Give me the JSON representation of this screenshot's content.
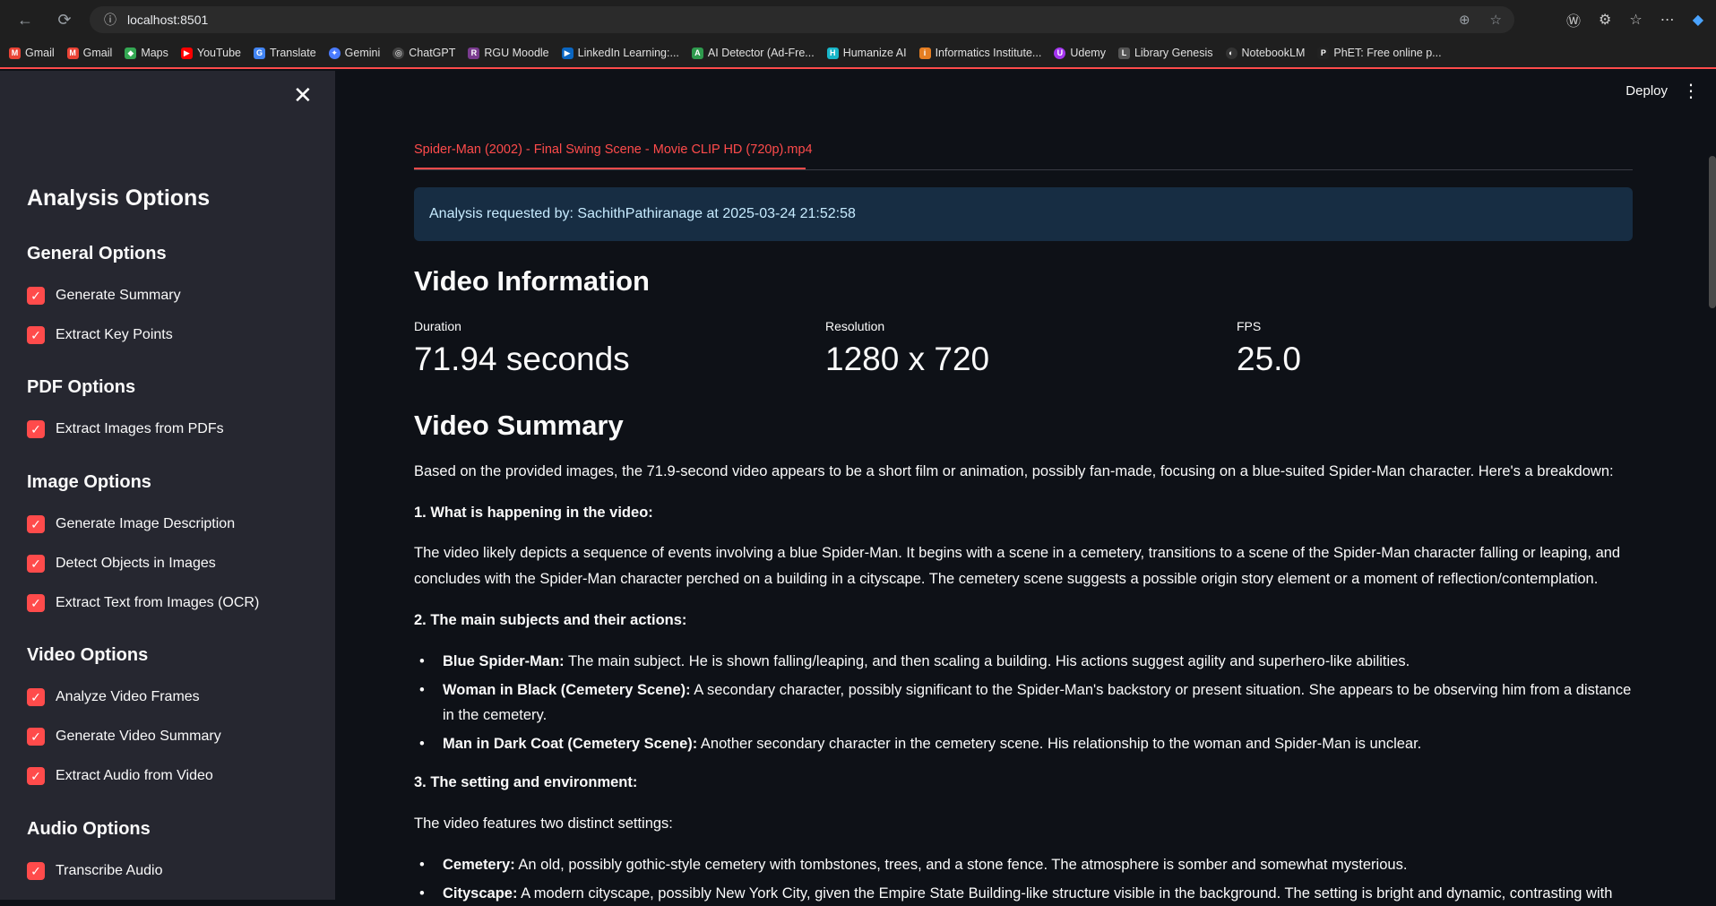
{
  "browser": {
    "url": "localhost:8501",
    "bookmarks": [
      "Gmail",
      "Gmail",
      "Maps",
      "YouTube",
      "Translate",
      "Gemini",
      "ChatGPT",
      "RGU Moodle",
      "LinkedIn Learning:...",
      "AI Detector (Ad-Fre...",
      "Humanize AI",
      "Informatics Institute...",
      "Udemy",
      "Library Genesis",
      "NotebookLM",
      "PhET: Free online p..."
    ]
  },
  "sidebar": {
    "title": "Analysis Options",
    "sections": [
      {
        "title": "General Options",
        "items": [
          "Generate Summary",
          "Extract Key Points"
        ]
      },
      {
        "title": "PDF Options",
        "items": [
          "Extract Images from PDFs"
        ]
      },
      {
        "title": "Image Options",
        "items": [
          "Generate Image Description",
          "Detect Objects in Images",
          "Extract Text from Images (OCR)"
        ]
      },
      {
        "title": "Video Options",
        "items": [
          "Analyze Video Frames",
          "Generate Video Summary",
          "Extract Audio from Video"
        ]
      },
      {
        "title": "Audio Options",
        "items": [
          "Transcribe Audio"
        ]
      }
    ]
  },
  "header": {
    "deploy": "Deploy"
  },
  "main": {
    "tab": "Spider-Man (2002) - Final Swing Scene - Movie CLIP HD (720p).mp4",
    "info": "Analysis requested by: SachithPathiranage at 2025-03-24 21:52:58",
    "video_info_title": "Video Information",
    "metrics": [
      {
        "label": "Duration",
        "value": "71.94 seconds"
      },
      {
        "label": "Resolution",
        "value": "1280 x 720"
      },
      {
        "label": "FPS",
        "value": "25.0"
      }
    ],
    "summary_title": "Video Summary",
    "intro": "Based on the provided images, the 71.9-second video appears to be a short film or animation, possibly fan-made, focusing on a blue-suited Spider-Man character. Here's a breakdown:",
    "h1": "1. What is happening in the video:",
    "p1": "The video likely depicts a sequence of events involving a blue Spider-Man. It begins with a scene in a cemetery, transitions to a scene of the Spider-Man character falling or leaping, and concludes with the Spider-Man character perched on a building in a cityscape. The cemetery scene suggests a possible origin story element or a moment of reflection/contemplation.",
    "h2": "2. The main subjects and their actions:",
    "b1_bold": "Blue Spider-Man:",
    "b1": " The main subject. He is shown falling/leaping, and then scaling a building. His actions suggest agility and superhero-like abilities.",
    "b2_bold": "Woman in Black (Cemetery Scene):",
    "b2": " A secondary character, possibly significant to the Spider-Man's backstory or present situation. She appears to be observing him from a distance in the cemetery.",
    "b3_bold": "Man in Dark Coat (Cemetery Scene):",
    "b3": " Another secondary character in the cemetery scene. His relationship to the woman and Spider-Man is unclear.",
    "h3": "3. The setting and environment:",
    "p3": "The video features two distinct settings:",
    "b4_bold": "Cemetery:",
    "b4": " An old, possibly gothic-style cemetery with tombstones, trees, and a stone fence. The atmosphere is somber and somewhat mysterious.",
    "b5_bold": "Cityscape:",
    "b5": " A modern cityscape, possibly New York City, given the Empire State Building-like structure visible in the background. The setting is bright and dynamic, contrasting with"
  }
}
